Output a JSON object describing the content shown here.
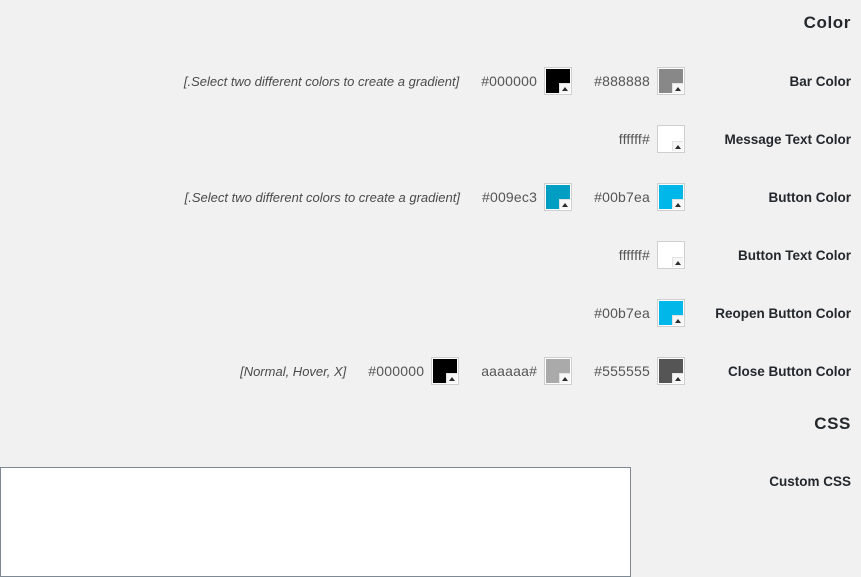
{
  "sections": {
    "color_heading": "Color",
    "css_heading": "CSS"
  },
  "rows": [
    {
      "label": "Bar Color",
      "hint": "[.Select two different colors to create a gradient]",
      "fields": [
        {
          "hex_text": "#000000",
          "color": "#000000"
        },
        {
          "hex_text": "#888888",
          "color": "#888888"
        }
      ]
    },
    {
      "label": "Message Text Color",
      "hint": "",
      "fields": [
        {
          "hex_text": "ffffff#",
          "color": "#ffffff"
        }
      ]
    },
    {
      "label": "Button Color",
      "hint": "[.Select two different colors to create a gradient]",
      "fields": [
        {
          "hex_text": "#009ec3",
          "color": "#009ec3"
        },
        {
          "hex_text": "#00b7ea",
          "color": "#00b7ea"
        }
      ]
    },
    {
      "label": "Button Text Color",
      "hint": "",
      "fields": [
        {
          "hex_text": "ffffff#",
          "color": "#ffffff"
        }
      ]
    },
    {
      "label": "Reopen Button Color",
      "hint": "",
      "fields": [
        {
          "hex_text": "#00b7ea",
          "color": "#00b7ea"
        }
      ]
    },
    {
      "label": "Close Button Color",
      "hint": "[Normal, Hover, X]",
      "fields": [
        {
          "hex_text": "#000000",
          "color": "#000000"
        },
        {
          "hex_text": "aaaaaa#",
          "color": "#aaaaaa"
        },
        {
          "hex_text": "#555555",
          "color": "#555555"
        }
      ]
    }
  ],
  "custom_css": {
    "label": "Custom CSS",
    "value": "",
    "placeholder": ""
  }
}
